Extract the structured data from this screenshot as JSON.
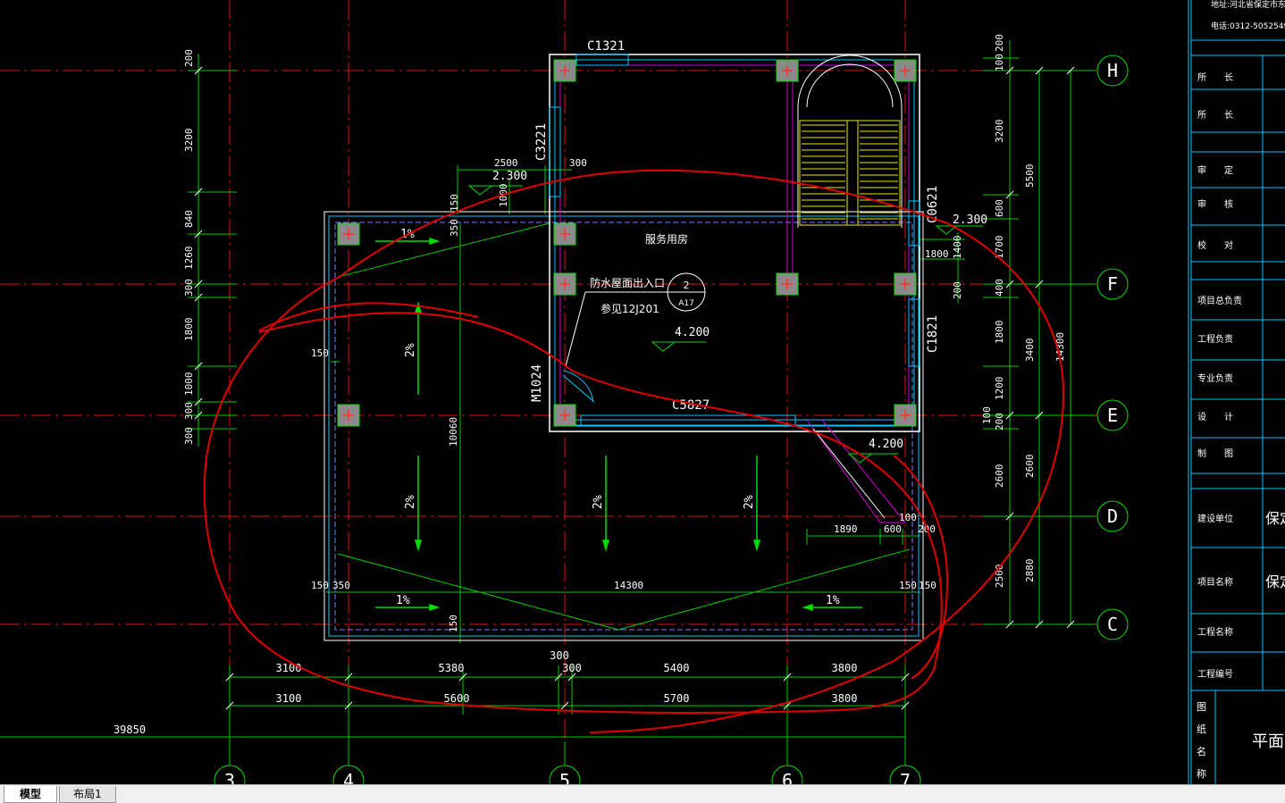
{
  "colors": {
    "background": "#000000",
    "axis": "#ff2020",
    "wall": "#ffffff",
    "inner": "#00d0ff",
    "dim": "#00dd00",
    "text": "#ffffff",
    "column": "#8a8a8a",
    "stair": "#e8e800",
    "door": "#d000d0",
    "annotation": "#e00000"
  },
  "grid_bubbles": [
    {
      "id": "H",
      "label": "H"
    },
    {
      "id": "F",
      "label": "F"
    },
    {
      "id": "E",
      "label": "E"
    },
    {
      "id": "D",
      "label": "D"
    },
    {
      "id": "C",
      "label": "C"
    },
    {
      "id": "3",
      "label": "3"
    },
    {
      "id": "4",
      "label": "4"
    },
    {
      "id": "5",
      "label": "5"
    },
    {
      "id": "6",
      "label": "6"
    },
    {
      "id": "7",
      "label": "7"
    }
  ],
  "windows": {
    "c1321": "C1321",
    "c3221": "C3221",
    "c0621": "C0621",
    "c1821": "C1821",
    "c5827": "C5827",
    "m1024": "M1024"
  },
  "rooms": {
    "service_room": "服务用房",
    "roof_exit": "防水屋面出入口",
    "reference": "参见12J201",
    "detail_no": "2",
    "detail_sheet": "A17"
  },
  "elevations": {
    "room": "4.200",
    "roof_right": "4.200",
    "eave_left": "2.300",
    "eave_right": "2.300"
  },
  "slopes": [
    "1%",
    "2%",
    "2%",
    "2%",
    "2%",
    "1%",
    "1%"
  ],
  "dims": {
    "left": [
      "200",
      "3200",
      "840",
      "1260",
      "300",
      "1800",
      "1000",
      "300",
      "300"
    ],
    "top_small": [
      "2500",
      "300",
      "1000",
      "150",
      "350"
    ],
    "inner": [
      "150",
      "10060",
      "1800",
      "1400",
      "200",
      "1890",
      "600",
      "100",
      "200",
      "150",
      "350",
      "14300",
      "150",
      "150",
      "150"
    ],
    "right_a": [
      "200",
      "100",
      "3200",
      "600",
      "1700",
      "400",
      "1800",
      "1200",
      "100",
      "200",
      "2600",
      "2500"
    ],
    "right_b": [
      "5500",
      "3400",
      "2600",
      "2880"
    ],
    "right_total": "14300",
    "bottom_1": [
      "3100",
      "5380",
      "300",
      "5400",
      "3800"
    ],
    "bottom_mid": "300",
    "bottom_2": [
      "3100",
      "5600",
      "5700",
      "3800"
    ],
    "bottom_total": "39850"
  },
  "title_block": {
    "header_addr": "地址:河北省保定市东",
    "header_tel": "电话:0312-5052549",
    "rows": [
      "所　　长",
      "所　　长",
      "审　　定",
      "审　　核",
      "校　　对",
      "项目总负责",
      "工程负责",
      "专业负责",
      "设　　计",
      "制　　图",
      "建设单位",
      "项目名称",
      "工程名称",
      "工程编号"
    ],
    "values": [
      "",
      "",
      "",
      "",
      "",
      "",
      "",
      "",
      "",
      "",
      "保定",
      "保定",
      "",
      ""
    ],
    "drawing_name_label": [
      "图",
      "纸",
      "名",
      "称"
    ],
    "drawing_name": "平面图"
  },
  "tabs": [
    {
      "label": "模型",
      "active": true
    },
    {
      "label": "布局1",
      "active": false
    }
  ]
}
